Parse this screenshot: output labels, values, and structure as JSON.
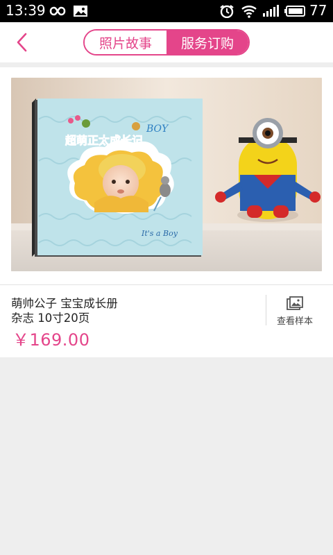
{
  "status_bar": {
    "time": "13:39",
    "battery": "77"
  },
  "header": {
    "back_icon": "chevron-left-icon",
    "tabs": [
      {
        "label": "照片故事",
        "active": false
      },
      {
        "label": "服务订购",
        "active": true
      }
    ]
  },
  "product": {
    "image_title": "超萌正太成长记",
    "image_boy_label": "BOY",
    "image_script": "It's a Boy",
    "name": "萌帅公子 宝宝成长册",
    "spec": "杂志  10寸20页",
    "price": "￥169.00",
    "sample_button": "查看样本",
    "sample_icon": "gallery-icon"
  },
  "colors": {
    "accent": "#e4458a",
    "status_bar": "#000000",
    "background": "#eeeeee"
  }
}
